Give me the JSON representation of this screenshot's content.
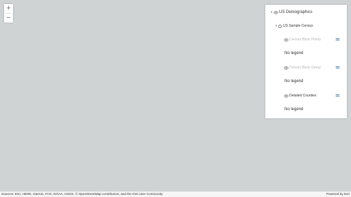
{
  "zoom": {
    "in_label": "+",
    "out_label": "−"
  },
  "layer_list": {
    "group_title": "US Demographics",
    "sublayer_title": "US Sample Census",
    "layers": [
      {
        "title": "Census Block Points",
        "visible": false,
        "legend_text": "No legend"
      },
      {
        "title": "Census Block Group",
        "visible": false,
        "legend_text": "No legend"
      },
      {
        "title": "Detailed Counties",
        "visible": true,
        "legend_text": "No legend"
      }
    ]
  },
  "attribution": {
    "sources": "Sources: Esri, HERE, Garmin, FAO, NOAA, USGS, © OpenStreetMap contributors, and the GIS User Community",
    "powered_by": "Powered by Esri"
  },
  "colors": {
    "map_background": "#cfd3d4",
    "panel_background": "#ffffff",
    "dimmed_text": "#b3b3b3",
    "legend_button": "#e6eef7"
  }
}
